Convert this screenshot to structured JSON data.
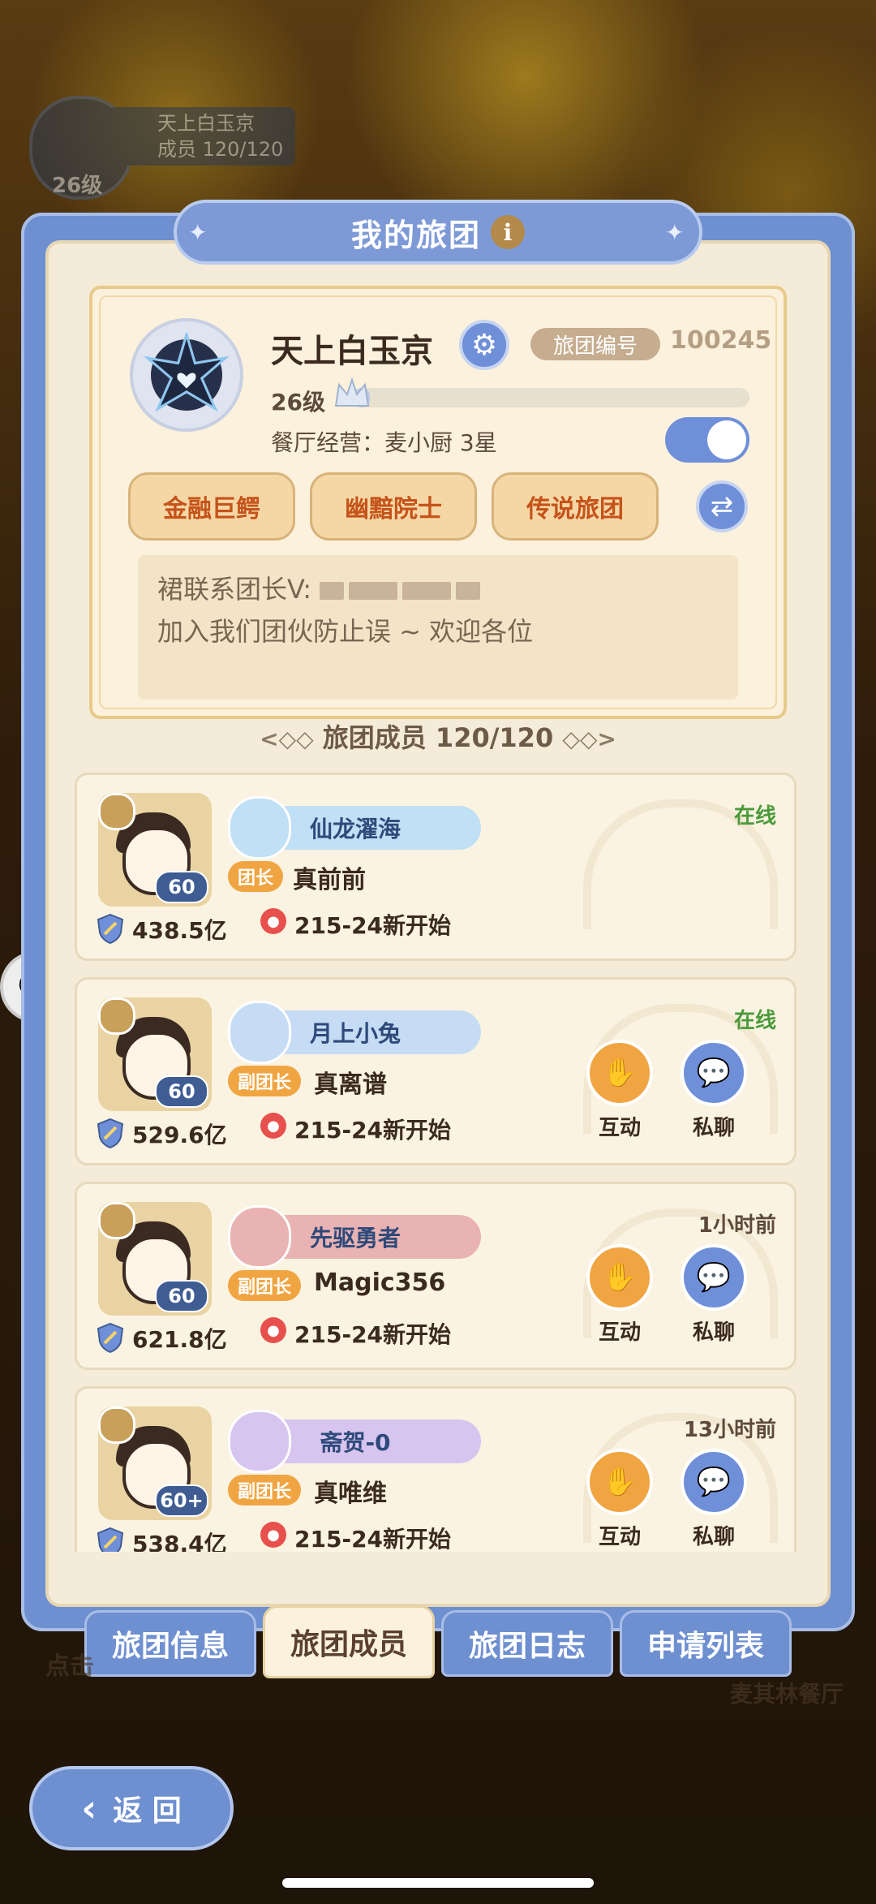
{
  "background_guild": {
    "name": "天上白玉京",
    "members": "成员  120/120",
    "level": "26级"
  },
  "panel": {
    "title": "我的旅团",
    "info_icon": "i"
  },
  "guild": {
    "name": "天上白玉京",
    "id_label": "旅团编号",
    "id": "100245",
    "level": "26级",
    "level_progress": 0.04,
    "restaurant": "餐厅经营：麦小厨 3星",
    "toggle_on": true,
    "tags": [
      "金融巨鳄",
      "幽黯院士",
      "传说旅团"
    ],
    "notice_line1": "裙联系团长V:",
    "notice_line2": "加入我们团伙防止误  ~  欢迎各位"
  },
  "members_header": {
    "label": "旅团成员 120/120",
    "left_orn": "<◇◇",
    "right_orn": "◇◇>"
  },
  "members": [
    {
      "title": "仙龙濯海",
      "role": "团长",
      "name": "真前前",
      "level": "60",
      "power": "438.5亿",
      "location": "215-24新开始",
      "status": "在线",
      "status_color": "#4a9a3a",
      "show_actions": false,
      "plate_color": "#bfe0f5"
    },
    {
      "title": "月上小兔",
      "role": "副团长",
      "name": "真离谱",
      "level": "60",
      "power": "529.6亿",
      "location": "215-24新开始",
      "status": "在线",
      "status_color": "#4a9a3a",
      "show_actions": true,
      "plate_color": "#c6dcf5"
    },
    {
      "title": "先驱勇者",
      "role": "副团长",
      "name": "Magic356",
      "level": "60",
      "power": "621.8亿",
      "location": "215-24新开始",
      "status": "1小时前",
      "status_color": "#5d4a3b",
      "show_actions": true,
      "plate_color": "#eab3b3"
    },
    {
      "title": "斋贺-0",
      "role": "副团长",
      "name": "真唯维",
      "level": "60+",
      "power": "538.4亿",
      "location": "215-24新开始",
      "status": "13小时前",
      "status_color": "#5d4a3b",
      "show_actions": true,
      "plate_color": "#d7c4ef"
    }
  ],
  "actions": {
    "interact": "互动",
    "chat": "私聊"
  },
  "tabs": [
    "旅团信息",
    "旅团成员",
    "旅团日志",
    "申请列表"
  ],
  "active_tab": 1,
  "background_labels": {
    "hint": "点击",
    "restaurant": "麦其林餐厅"
  },
  "back_button": "返 回",
  "colors": {
    "panel_blue": "#6e8fd0",
    "tag_text": "#c5531a",
    "role_orange": "#f0a542",
    "online_green": "#4a9a3a"
  }
}
